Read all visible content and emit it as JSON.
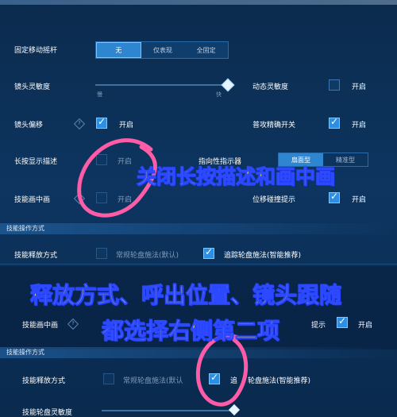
{
  "settings": {
    "fixed_joystick_label": "固定移动摇杆",
    "fixed_joystick_options": [
      "无",
      "仅表现",
      "全固定"
    ],
    "camera_sensitivity_label": "镜头灵敏度",
    "slow_label": "慢",
    "fast_label": "快",
    "dynamic_sensitivity_label": "动态灵敏度",
    "enable_label": "开启",
    "camera_offset_label": "镜头偏移",
    "normal_precise_toggle_label": "普攻精确开关",
    "long_press_desc_label": "长按显示描述",
    "indicator_label": "指向性指示器",
    "indicator_options": [
      "扇面型",
      "精准型"
    ],
    "skill_pip_label": "技能画中画",
    "displacement_hint_label": "位移碰撞提示",
    "skill_section_label": "技能操作方式",
    "skill_release_label": "技能释放方式",
    "normal_wheel_label": "常规轮盘施法(默认)",
    "follow_wheel_label": "追踪轮盘施法(智能推荐)",
    "follow_wheel_label_cut": "追",
    "follow_wheel_label_tail": "轮盘施法(智能推荐)",
    "skill_pip_label_2": "技能画中画",
    "hint_label_2": "提示",
    "skill_section_label_2": "技能操作方式",
    "skill_release_label_2": "技能释放方式",
    "normal_wheel_label_2": "常规轮盘施法(默认",
    "bottom_cut_label": "技能轮盘灵敏度"
  },
  "captions": {
    "caption_1": "关闭长按描述和画中画",
    "caption_2": "释放方式、呼出位置、镜头跟随",
    "caption_3": "都选择右侧第二项"
  },
  "colors": {
    "accent": "#2c8fe6",
    "caption_fill": "#ffe23a",
    "caption_stroke": "#2d49ff",
    "annotation_circle": "#ff5ca8"
  }
}
